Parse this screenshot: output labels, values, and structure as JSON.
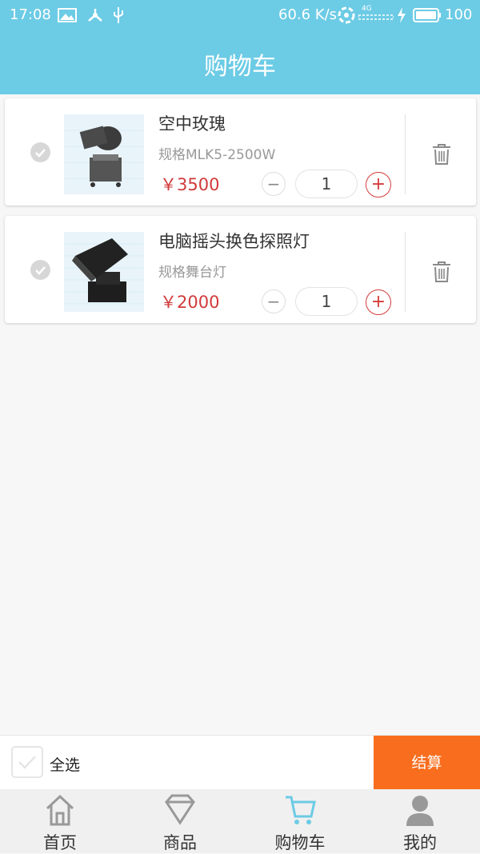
{
  "status_bar": {
    "time": "17:08",
    "network_speed": "60.6 K/s",
    "signal_label": "4G",
    "battery": "100"
  },
  "header": {
    "title": "购物车"
  },
  "cart": {
    "items": [
      {
        "name": "空中玫瑰",
        "spec": "规格MLK5-2500W",
        "price": "￥3500",
        "quantity": "1",
        "minus": "−",
        "plus": "+"
      },
      {
        "name": "电脑摇头换色探照灯",
        "spec": "规格舞台灯",
        "price": "￥2000",
        "quantity": "1",
        "minus": "−",
        "plus": "+"
      }
    ]
  },
  "footer": {
    "select_all": "全选",
    "checkout": "结算"
  },
  "tabs": [
    {
      "label": "首页",
      "icon": "home-icon"
    },
    {
      "label": "商品",
      "icon": "diamond-icon"
    },
    {
      "label": "购物车",
      "icon": "cart-icon",
      "active": true
    },
    {
      "label": "我的",
      "icon": "person-icon"
    }
  ],
  "colors": {
    "header": "#6ccbe5",
    "price": "#d13a3a",
    "checkout": "#f86e1e",
    "active_tab_icon": "#6ccbe5"
  }
}
